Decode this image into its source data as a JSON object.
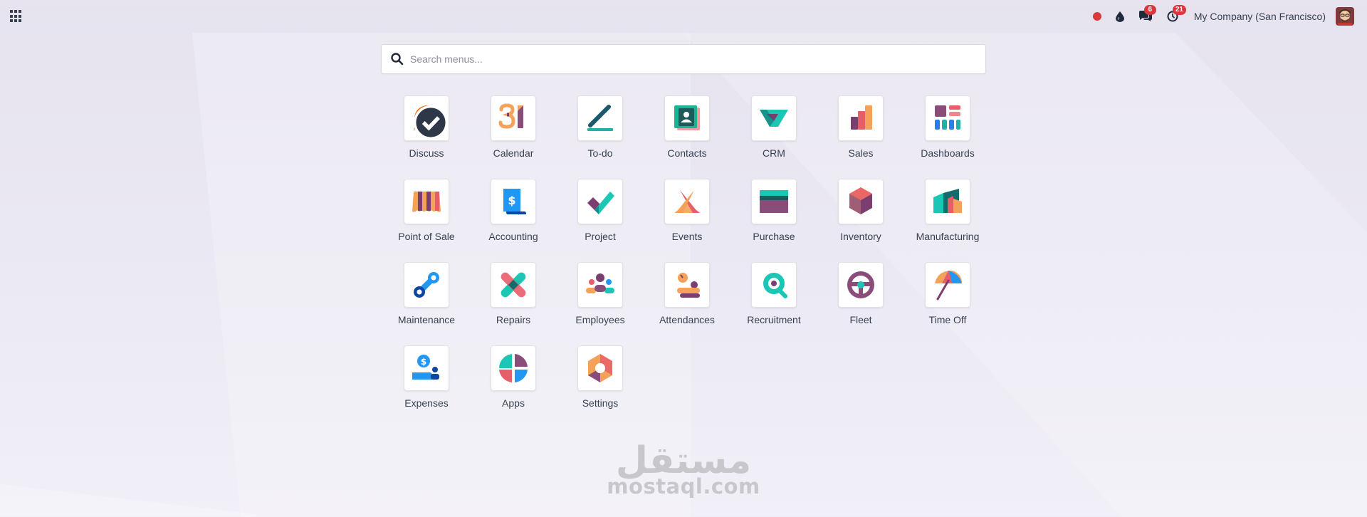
{
  "topbar": {
    "apps_menu_icon": "grid-icon",
    "systray": {
      "recorder_icon": "record-dot-icon",
      "debug_icon": "drop-icon",
      "messages_icon": "chat-icon",
      "messages_count": "6",
      "activities_icon": "clock-icon",
      "activities_count": "21",
      "company": "My Company (San Francisco)",
      "avatar_icon": "user-avatar"
    }
  },
  "search": {
    "placeholder": "Search menus...",
    "value": "",
    "icon": "search-icon"
  },
  "apps": [
    {
      "label": "Discuss",
      "icon": "discuss-icon"
    },
    {
      "label": "Calendar",
      "icon": "calendar-icon"
    },
    {
      "label": "To-do",
      "icon": "todo-icon"
    },
    {
      "label": "Contacts",
      "icon": "contacts-icon"
    },
    {
      "label": "CRM",
      "icon": "crm-icon"
    },
    {
      "label": "Sales",
      "icon": "sales-icon"
    },
    {
      "label": "Dashboards",
      "icon": "dashboards-icon"
    },
    {
      "label": "Point of Sale",
      "icon": "point-of-sale-icon"
    },
    {
      "label": "Accounting",
      "icon": "accounting-icon"
    },
    {
      "label": "Project",
      "icon": "project-icon"
    },
    {
      "label": "Events",
      "icon": "events-icon"
    },
    {
      "label": "Purchase",
      "icon": "purchase-icon"
    },
    {
      "label": "Inventory",
      "icon": "inventory-icon"
    },
    {
      "label": "Manufacturing",
      "icon": "manufacturing-icon"
    },
    {
      "label": "Maintenance",
      "icon": "maintenance-icon"
    },
    {
      "label": "Repairs",
      "icon": "repairs-icon"
    },
    {
      "label": "Employees",
      "icon": "employees-icon"
    },
    {
      "label": "Attendances",
      "icon": "attendances-icon"
    },
    {
      "label": "Recruitment",
      "icon": "recruitment-icon"
    },
    {
      "label": "Fleet",
      "icon": "fleet-icon"
    },
    {
      "label": "Time Off",
      "icon": "time-off-icon"
    },
    {
      "label": "Expenses",
      "icon": "expenses-icon"
    },
    {
      "label": "Apps",
      "icon": "apps-icon"
    },
    {
      "label": "Settings",
      "icon": "settings-icon"
    }
  ],
  "watermark": {
    "arabic": "مستقل",
    "latin": "mostaql.com"
  },
  "colors": {
    "badge": "#d9363e",
    "recorder": "#d63a3a",
    "text": "#374151"
  }
}
